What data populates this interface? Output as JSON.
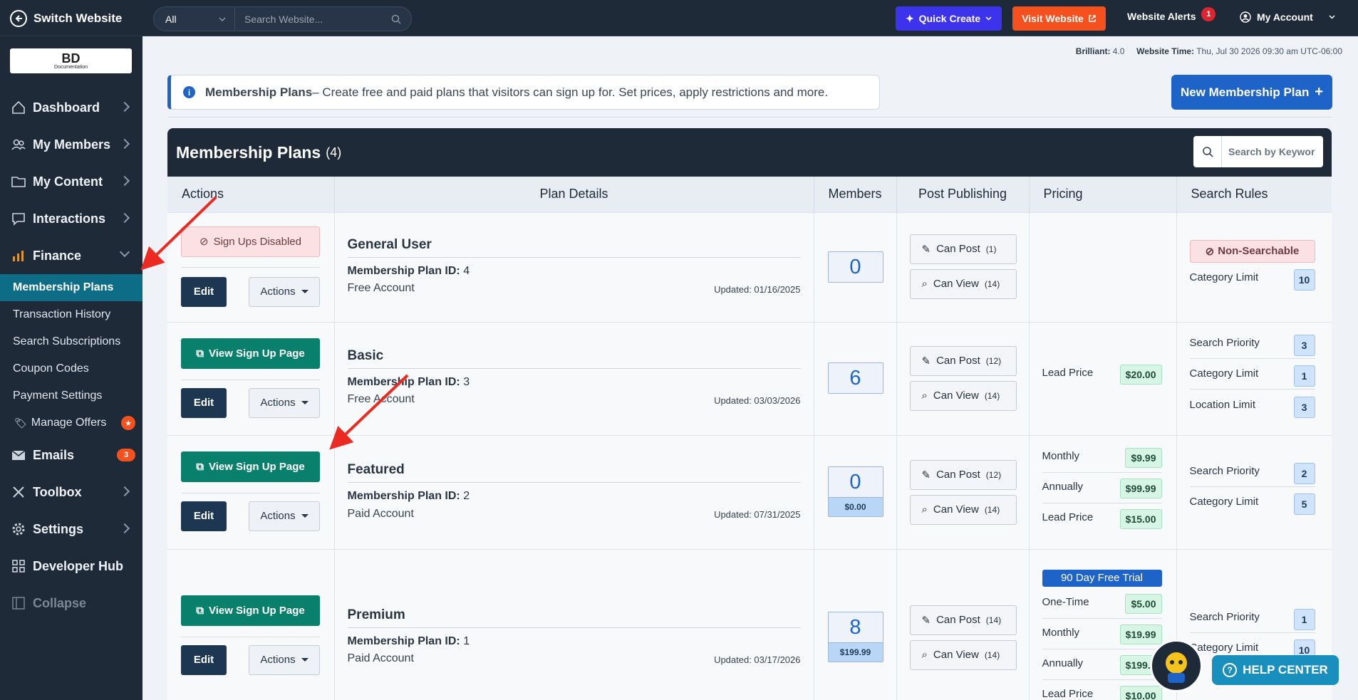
{
  "topbar": {
    "switch_label": "Switch Website",
    "search_scope": "All",
    "search_placeholder": "Search Website...",
    "quick_create": "Quick Create",
    "visit_website": "Visit Website",
    "alerts_label": "Website Alerts",
    "alerts_count": "1",
    "account_label": "My Account"
  },
  "sidebar": {
    "logo_text": "BD",
    "logo_sub": "Documentation",
    "nav": {
      "dashboard": "Dashboard",
      "members": "My Members",
      "content": "My Content",
      "interactions": "Interactions",
      "finance": "Finance",
      "emails": "Emails",
      "emails_badge": "3",
      "toolbox": "Toolbox",
      "settings": "Settings",
      "devhub": "Developer Hub",
      "collapse": "Collapse"
    },
    "finance_sub": {
      "plans": "Membership Plans",
      "transactions": "Transaction History",
      "subscriptions": "Search Subscriptions",
      "coupons": "Coupon Codes",
      "payment": "Payment Settings",
      "offers": "Manage Offers"
    }
  },
  "meta": {
    "version_label": "Brilliant:",
    "version": "4.0",
    "time_label": "Website Time:",
    "time": "Thu, Jul 30 2026 09:30 am UTC-06:00"
  },
  "info": {
    "title": "Membership Plans",
    "text": " – Create free and paid plans that visitors can sign up for. Set prices, apply restrictions and more."
  },
  "new_plan": "New Membership Plan",
  "panel": {
    "title": "Membership Plans",
    "count": "(4)",
    "search_placeholder": "Search by Keywor"
  },
  "columns": [
    "Actions",
    "Plan Details",
    "Members",
    "Post Publishing",
    "Pricing",
    "Search Rules"
  ],
  "labels": {
    "edit": "Edit",
    "actions": "Actions",
    "view_signup": "View Sign Up Page",
    "signups_disabled": "Sign Ups Disabled",
    "plan_id": "Membership Plan ID:",
    "can_post": "Can Post",
    "can_view": "Can View",
    "non_searchable": "Non-Searchable"
  },
  "plans": [
    {
      "name": "General User",
      "id": "4",
      "type": "Free Account",
      "updated": "Updated: 01/16/2025",
      "members": "0",
      "post": "(1)",
      "view": "(14)",
      "rules": [
        {
          "label": "Category Limit",
          "value": "10"
        }
      ]
    },
    {
      "name": "Basic",
      "id": "3",
      "type": "Free Account",
      "updated": "Updated: 03/03/2026",
      "members": "6",
      "post": "(12)",
      "view": "(14)",
      "pricing": [
        {
          "label": "Lead Price",
          "value": "$20.00"
        }
      ],
      "rules": [
        {
          "label": "Search Priority",
          "value": "3"
        },
        {
          "label": "Category Limit",
          "value": "1"
        },
        {
          "label": "Location Limit",
          "value": "3"
        }
      ]
    },
    {
      "name": "Featured",
      "id": "2",
      "type": "Paid Account",
      "updated": "Updated: 07/31/2025",
      "members": "0",
      "members_price": "$0.00",
      "post": "(12)",
      "view": "(14)",
      "pricing": [
        {
          "label": "Monthly",
          "value": "$9.99"
        },
        {
          "label": "Annually",
          "value": "$99.99"
        },
        {
          "label": "Lead Price",
          "value": "$15.00"
        }
      ],
      "rules": [
        {
          "label": "Search Priority",
          "value": "2"
        },
        {
          "label": "Category Limit",
          "value": "5"
        }
      ]
    },
    {
      "name": "Premium",
      "id": "1",
      "type": "Paid Account",
      "updated": "Updated: 03/17/2026",
      "members": "8",
      "members_price": "$199.99",
      "post": "(14)",
      "view": "(14)",
      "trial": "90 Day Free Trial",
      "pricing": [
        {
          "label": "One-Time",
          "value": "$5.00"
        },
        {
          "label": "Monthly",
          "value": "$19.99"
        },
        {
          "label": "Annually",
          "value": "$199.9"
        },
        {
          "label": "Lead Price",
          "value": "$10.00"
        }
      ],
      "rules": [
        {
          "label": "Search Priority",
          "value": "1"
        },
        {
          "label": "Category Limit",
          "value": "10"
        }
      ]
    }
  ],
  "help_center": "HELP CENTER",
  "colors": {
    "accent": "#1e63c8",
    "green": "#09806b",
    "sidebar": "#1f2a39",
    "active": "#0d6d86",
    "arrow": "#ec2a22"
  }
}
